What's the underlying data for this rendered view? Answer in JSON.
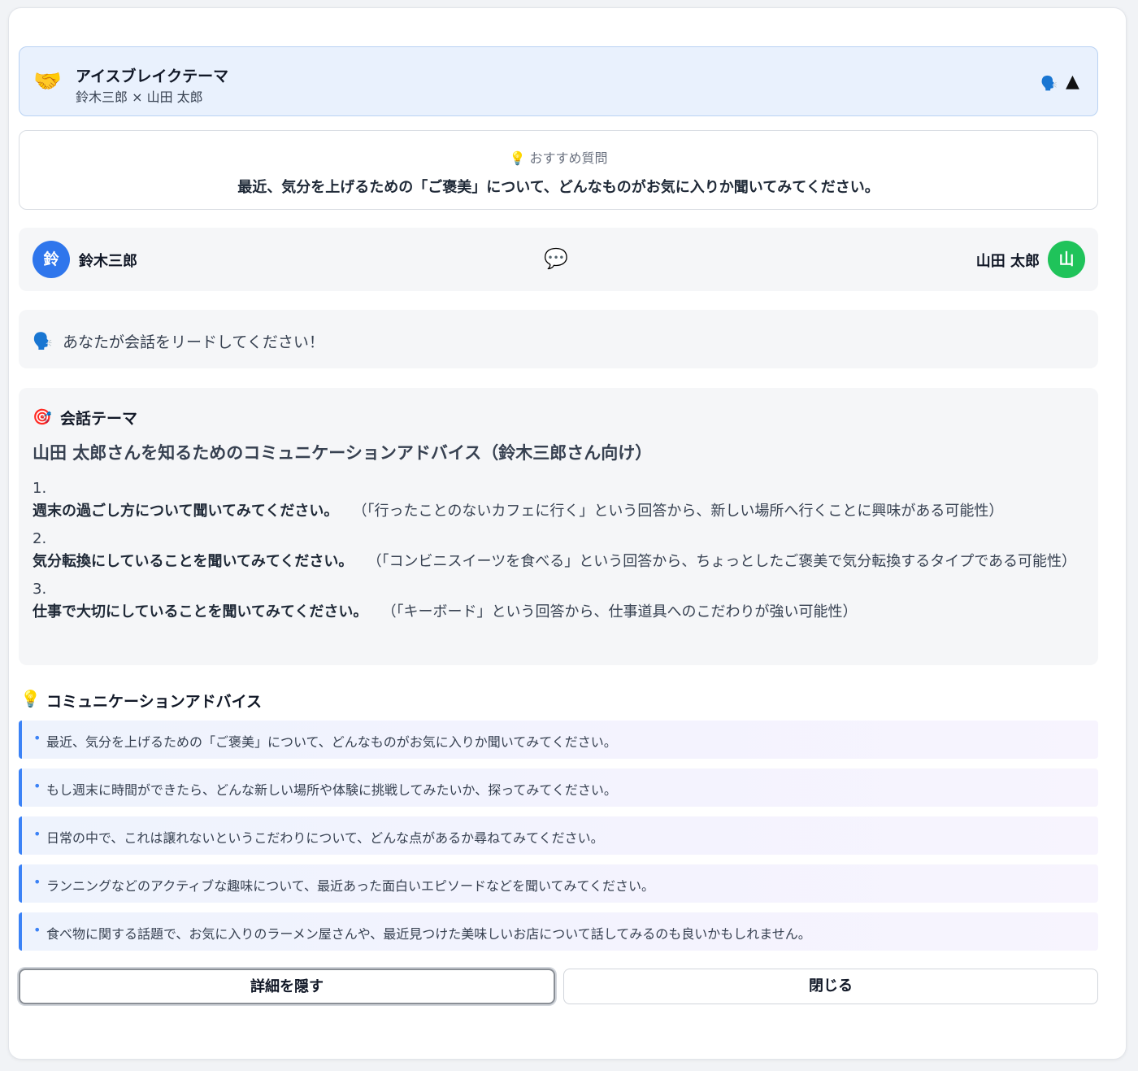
{
  "header": {
    "title": "アイスブレイクテーマ",
    "subtitle": "鈴木三郎 × 山田 太郎",
    "handshake_icon": "handshake-icon",
    "speak_icon": "speaking-head-icon",
    "collapse_icon": "triangle-up-icon",
    "collapse_glyph": "▲"
  },
  "recommend": {
    "label": "💡 おすすめ質問",
    "question": "最近、気分を上げるための「ご褒美」について、どんなものがお気に入りか聞いてみてください。"
  },
  "pair": {
    "left": {
      "initial": "鈴",
      "name": "鈴木三郎",
      "color": "#2f76ec"
    },
    "right": {
      "initial": "山",
      "name": "山田 太郎",
      "color": "#1fc35a"
    },
    "bubble": "💬"
  },
  "lead": {
    "icon": "🗣️",
    "text": "あなたが会話をリードしてください！"
  },
  "theme": {
    "icon": "🎯",
    "heading": "会話テーマ",
    "title": "山田 太郎さんを知るためのコミュニケーションアドバイス（鈴木三郎さん向け）",
    "items": [
      {
        "num": "1.",
        "bold": "週末の過ごし方について聞いてみてください。",
        "note": "（「行ったことのないカフェに行く」という回答から、新しい場所へ行くことに興味がある可能性）"
      },
      {
        "num": "2.",
        "bold": "気分転換にしていることを聞いてみてください。",
        "note": "（「コンビニスイーツを食べる」という回答から、ちょっとしたご褒美で気分転換するタイプである可能性）"
      },
      {
        "num": "3.",
        "bold": "仕事で大切にしていることを聞いてみてください。",
        "note": "（「キーボード」という回答から、仕事道具へのこだわりが強い可能性）"
      }
    ]
  },
  "advice": {
    "icon": "💡",
    "heading": "コミュニケーションアドバイス",
    "bullet": "•",
    "items": [
      "最近、気分を上げるための「ご褒美」について、どんなものがお気に入りか聞いてみてください。",
      "もし週末に時間ができたら、どんな新しい場所や体験に挑戦してみたいか、探ってみてください。",
      "日常の中で、これは譲れないというこだわりについて、どんな点があるか尋ねてみてください。",
      "ランニングなどのアクティブな趣味について、最近あった面白いエピソードなどを聞いてみてください。",
      "食べ物に関する話題で、お気に入りのラーメン屋さんや、最近見つけた美味しいお店について話してみるのも良いかもしれません。"
    ]
  },
  "buttons": {
    "hide": "詳細を隠す",
    "close": "閉じる"
  }
}
